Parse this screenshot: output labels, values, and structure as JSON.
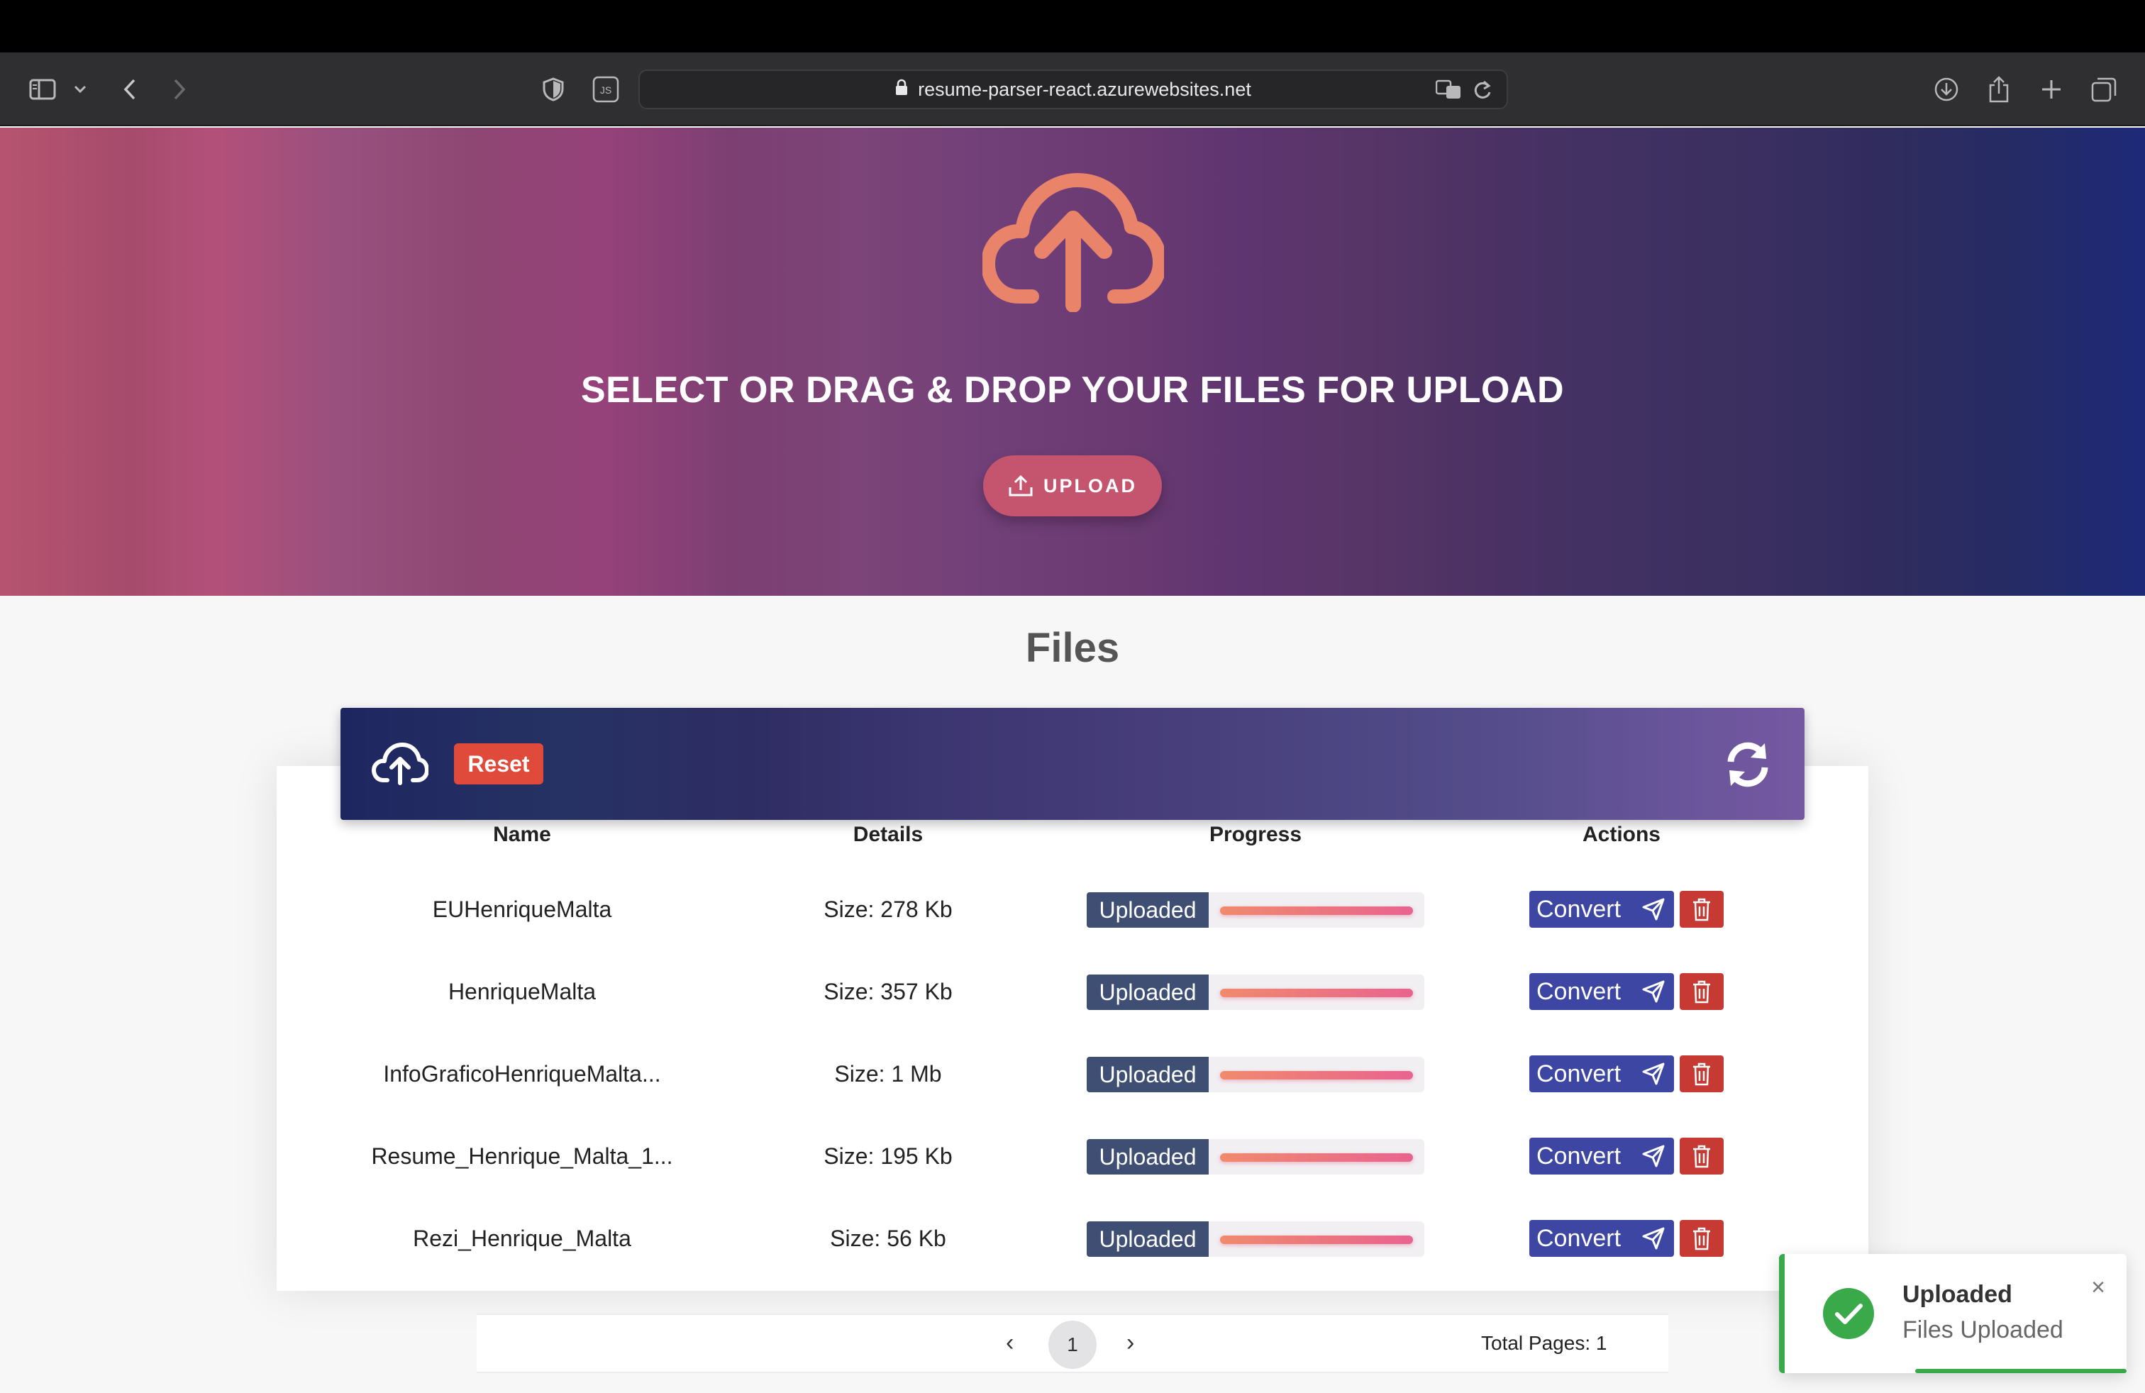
{
  "browser": {
    "url": "resume-parser-react.azurewebsites.net",
    "js_badge": "JS"
  },
  "hero": {
    "title": "SELECT OR DRAG & DROP YOUR FILES FOR UPLOAD",
    "upload_label": "UPLOAD"
  },
  "files": {
    "title": "Files",
    "reset_label": "Reset",
    "columns": [
      "Name",
      "Details",
      "Progress",
      "Actions"
    ],
    "rows": [
      {
        "name": "EUHenriqueMalta",
        "details": "Size: 278 Kb",
        "status": "Uploaded",
        "progress": 1.0,
        "convert": "Convert"
      },
      {
        "name": "HenriqueMalta",
        "details": "Size: 357 Kb",
        "status": "Uploaded",
        "progress": 1.0,
        "convert": "Convert"
      },
      {
        "name": "InfoGraficoHenriqueMalta...",
        "details": "Size: 1 Mb",
        "status": "Uploaded",
        "progress": 1.0,
        "convert": "Convert"
      },
      {
        "name": "Resume_Henrique_Malta_1...",
        "details": "Size: 195 Kb",
        "status": "Uploaded",
        "progress": 1.0,
        "convert": "Convert"
      },
      {
        "name": "Rezi_Henrique_Malta",
        "details": "Size: 56 Kb",
        "status": "Uploaded",
        "progress": 1.0,
        "convert": "Convert"
      }
    ]
  },
  "pagination": {
    "prev": "‹",
    "current": "1",
    "next": "›",
    "total": "Total Pages: 1"
  },
  "toast": {
    "title": "Uploaded",
    "message": "Files Uploaded",
    "close": "×"
  },
  "colors": {
    "accent": "#3d47a3",
    "danger": "#c63a33",
    "success": "#3aa94a",
    "upload_icon": "#e9836a"
  }
}
